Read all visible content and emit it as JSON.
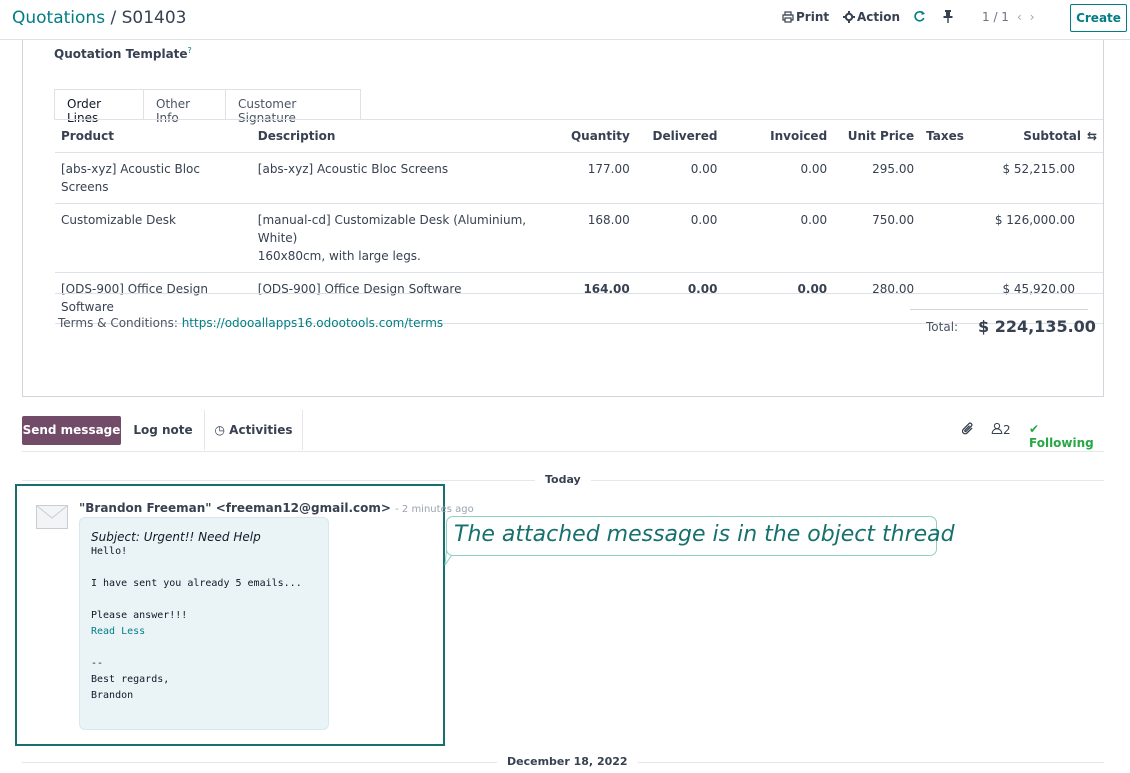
{
  "breadcrumb": {
    "parent": "Quotations",
    "separator": " / ",
    "current": "S01403"
  },
  "toolbar": {
    "print": "Print",
    "action": "Action",
    "pager": "1 / 1",
    "create": "Create"
  },
  "form": {
    "quotation_template_label": "Quotation Template",
    "help_mark": "?",
    "tabs": [
      "Order Lines",
      "Other Info",
      "Customer Signature"
    ]
  },
  "order_lines": {
    "columns": [
      "Product",
      "Description",
      "Quantity",
      "Delivered",
      "Invoiced",
      "Unit Price",
      "Taxes",
      "Subtotal"
    ],
    "rows": [
      {
        "product": "[abs-xyz] Acoustic Bloc Screens",
        "description": "[abs-xyz] Acoustic Bloc Screens",
        "description2": "",
        "quantity": "177.00",
        "delivered": "0.00",
        "invoiced": "0.00",
        "unit_price": "295.00",
        "taxes": "",
        "subtotal": "$ 52,215.00"
      },
      {
        "product": "Customizable Desk",
        "description": "[manual-cd] Customizable Desk (Aluminium, White)",
        "description2": "160x80cm, with large legs.",
        "quantity": "168.00",
        "delivered": "0.00",
        "invoiced": "0.00",
        "unit_price": "750.00",
        "taxes": "",
        "subtotal": "$ 126,000.00"
      },
      {
        "product": "[ODS-900] Office Design Software",
        "description": "[ODS-900] Office Design Software",
        "description2": "",
        "quantity": "164.00",
        "delivered": "0.00",
        "invoiced": "0.00",
        "unit_price": "280.00",
        "taxes": "",
        "subtotal": "$ 45,920.00"
      }
    ]
  },
  "terms": {
    "label": "Terms & Conditions: ",
    "url": "https://odooallapps16.odootools.com/terms"
  },
  "total": {
    "label": "Total:",
    "value": "$ 224,135.00"
  },
  "chatter": {
    "send_message": "Send message",
    "log_note": "Log note",
    "activities": "Activities",
    "followers_count": "2",
    "following": "Following",
    "day_today": "Today",
    "day_other": "December 18, 2022"
  },
  "message": {
    "author": "\"Brandon Freeman\" <freeman12@gmail.com>",
    "time": "- 2 minutes ago",
    "subject": "Subject: Urgent!! Need Help",
    "body_lines": [
      "Hello!",
      "",
      "I have sent you already 5 emails...",
      "",
      "Please answer!!!"
    ],
    "read_less": "Read Less",
    "signature_lines": [
      "",
      "--",
      "Best regards,",
      "Brandon"
    ]
  },
  "callout": {
    "text": "The attached message is in the object thread"
  },
  "colors": {
    "brand_teal": "#017e84",
    "send_button": "#714b67",
    "following_green": "#28a745",
    "frame_border": "#17706e"
  }
}
